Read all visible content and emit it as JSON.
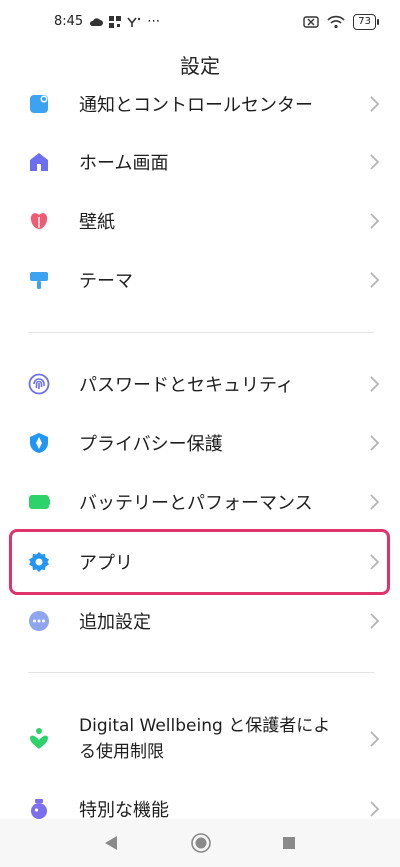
{
  "status": {
    "time": "8:45",
    "extra_icons": "⋯",
    "battery": "73"
  },
  "header": {
    "title": "設定"
  },
  "items": [
    {
      "label": "通知とコントロールセンター",
      "icon": "notification-icon",
      "color": "#3ba3f2"
    },
    {
      "label": "ホーム画面",
      "icon": "home-icon",
      "color": "#6b6ff0"
    },
    {
      "label": "壁紙",
      "icon": "flower-icon",
      "color": "#f05a73"
    },
    {
      "label": "テーマ",
      "icon": "brush-icon",
      "color": "#3ba3f2"
    },
    {
      "label": "パスワードとセキュリティ",
      "icon": "fingerprint-icon",
      "color": "#6b6ff0"
    },
    {
      "label": "プライバシー保護",
      "icon": "shield-icon",
      "color": "#2196f3"
    },
    {
      "label": "バッテリーとパフォーマンス",
      "icon": "battery-icon",
      "color": "#2ed26b"
    },
    {
      "label": "アプリ",
      "icon": "gear-icon",
      "color": "#2196f3"
    },
    {
      "label": "追加設定",
      "icon": "more-icon",
      "color": "#8fa6ef"
    },
    {
      "label_line1": "Digital Wellbeing と保護者によ",
      "label_line2": "る使用制限",
      "icon": "wellbeing-icon",
      "color": "#2ed26b"
    },
    {
      "label": "特別な機能",
      "icon": "potion-icon",
      "color": "#7b6ff0"
    }
  ]
}
